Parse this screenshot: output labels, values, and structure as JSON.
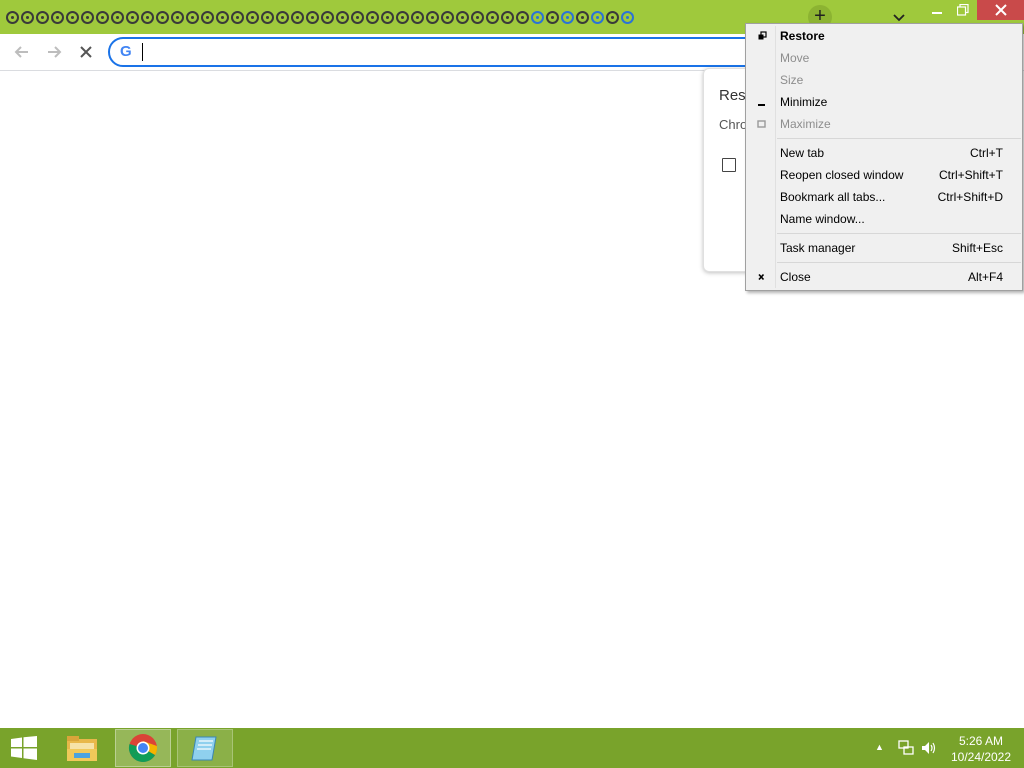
{
  "window": {
    "tab_icon_count": 42,
    "accent_color": "#9fc93c",
    "newtab_label": "+"
  },
  "toolbar": {
    "omnibox_value": "",
    "omnibox_icon": "google-g-icon",
    "omnibox_g": "G"
  },
  "restore_dialog": {
    "title": "Rest",
    "body": "Chro"
  },
  "sysmenu": {
    "items": [
      {
        "label": "Restore",
        "shortcut": "",
        "icon": "restore-icon",
        "enabled": true,
        "bold": true
      },
      {
        "label": "Move",
        "shortcut": "",
        "icon": "",
        "enabled": false
      },
      {
        "label": "Size",
        "shortcut": "",
        "icon": "",
        "enabled": false
      },
      {
        "label": "Minimize",
        "shortcut": "",
        "icon": "minimize-icon",
        "enabled": true
      },
      {
        "label": "Maximize",
        "shortcut": "",
        "icon": "maximize-icon",
        "enabled": false
      },
      {
        "label": "New tab",
        "shortcut": "Ctrl+T",
        "enabled": true
      },
      {
        "label": "Reopen closed window",
        "shortcut": "Ctrl+Shift+T",
        "enabled": true
      },
      {
        "label": "Bookmark all tabs...",
        "shortcut": "Ctrl+Shift+D",
        "enabled": true
      },
      {
        "label": "Name window...",
        "shortcut": "",
        "enabled": true
      },
      {
        "label": "Task manager",
        "shortcut": "Shift+Esc",
        "enabled": true
      },
      {
        "label": "Close",
        "shortcut": "Alt+F4",
        "icon": "close-icon",
        "enabled": true
      }
    ]
  },
  "taskbar": {
    "color": "#79a32b",
    "apps": [
      "file-explorer-icon",
      "chrome-icon",
      "notepad-icon"
    ],
    "time": "5:26 AM",
    "date": "10/24/2022"
  }
}
